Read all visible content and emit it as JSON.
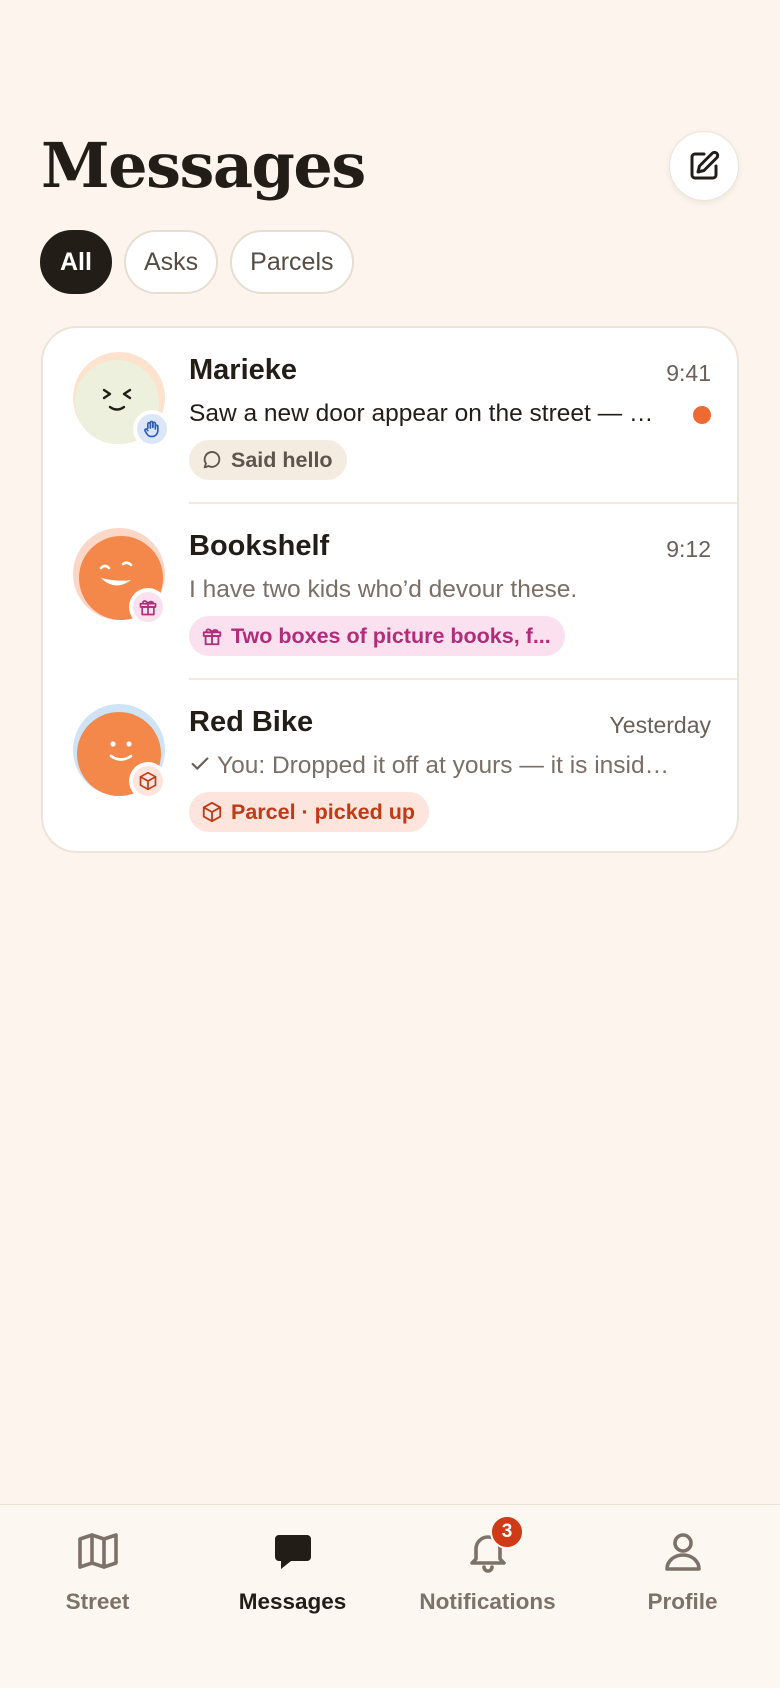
{
  "header": {
    "title": "Messages"
  },
  "filters": [
    {
      "label": "All",
      "active": true
    },
    {
      "label": "Asks",
      "active": false
    },
    {
      "label": "Parcels",
      "active": false
    }
  ],
  "conversations": [
    {
      "name": "Marieke",
      "time": "9:41",
      "preview": "Saw a new door appear on the street — welcome!",
      "unread": true,
      "tag": "Said hello",
      "badge_icon": "wave-hand-icon"
    },
    {
      "name": "Bookshelf",
      "time": "9:12",
      "preview": "I have two kids who’d devour these.",
      "unread": false,
      "tag": "Two boxes of picture books, f...",
      "badge_icon": "gift-icon"
    },
    {
      "name": "Red Bike",
      "time": "Yesterday",
      "preview": "You: Dropped it off at yours — it is inside the porch",
      "unread": false,
      "tag": "Parcel · picked up",
      "badge_icon": "parcel-icon"
    }
  ],
  "tabbar": {
    "items": [
      {
        "label": "Street",
        "icon": "map-icon",
        "active": false
      },
      {
        "label": "Messages",
        "icon": "chat-bubble-icon",
        "active": true
      },
      {
        "label": "Notifications",
        "icon": "bell-icon",
        "active": false,
        "badge": "3"
      },
      {
        "label": "Profile",
        "icon": "person-icon",
        "active": false
      }
    ]
  },
  "colors": {
    "background": "#fdf5ed",
    "ink": "#231d18",
    "unread_dot": "#ef6a33",
    "notification_badge": "#cf3a17"
  }
}
